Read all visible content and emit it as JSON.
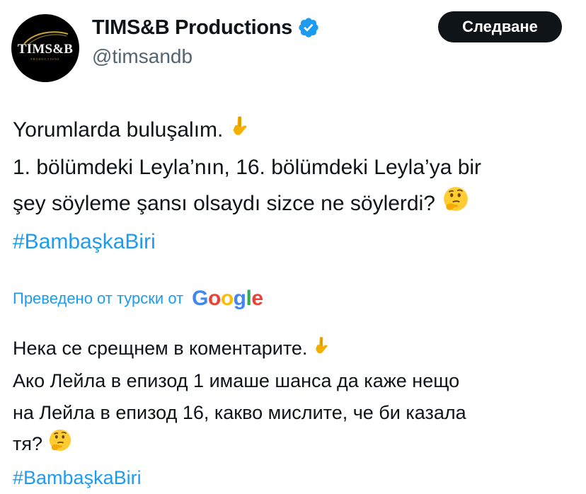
{
  "author": {
    "display_name": "TIMS&B Productions",
    "handle": "@timsandb",
    "verified": true,
    "avatar_text": "TIMS&B",
    "avatar_subtext": "PRODUCTIONS"
  },
  "follow_button": {
    "label": "Следване"
  },
  "tweet": {
    "lines": [
      "Yorumlarda buluşalım.",
      "1. bölümdeki Leyla’nın, 16. bölümdeki Leyla’ya bir",
      "şey söyleme şansı olsaydı sizce ne söylerdi?"
    ],
    "hashtag": "#BambaşkaBiri"
  },
  "translation": {
    "label": "Преведено от турски от",
    "provider_logo": "Google",
    "lines": [
      "Нека се срещнем в коментарите.",
      "Ако Лейла в епизод 1 имаше шанса да каже нещо",
      "на Лейла в епизод 16, какво мислите, че би казала",
      "тя?"
    ],
    "hashtag": "#BambaşkaBiri"
  },
  "icons": {
    "verified": "verified-badge-icon",
    "point_down": "point-down-emoji",
    "thinking": "thinking-face-emoji"
  },
  "colors": {
    "link": "#1d9bf0",
    "text": "#0f1419",
    "secondary": "#536471",
    "button_bg": "#0f1419"
  }
}
